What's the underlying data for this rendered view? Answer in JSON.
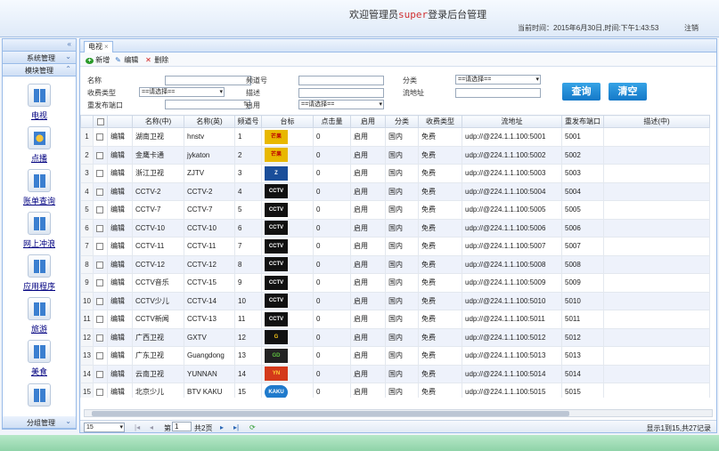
{
  "header": {
    "title_prefix": "欢迎管理员",
    "title_user": "super",
    "title_suffix": "登录后台管理",
    "time": "当前时间：2015年6月30日,时间:下午1:43:53",
    "logout": "注销"
  },
  "sidebar": {
    "collapse": "«",
    "system": "系统管理",
    "module": "模块管理",
    "group": "分组管理",
    "items": [
      {
        "label": "电视",
        "icon": "tv-icon"
      },
      {
        "label": "点播",
        "icon": "vod-icon"
      },
      {
        "label": "账单查询",
        "icon": "bill-icon"
      },
      {
        "label": "网上冲浪",
        "icon": "web-icon"
      },
      {
        "label": "应用程序",
        "icon": "apps-icon"
      },
      {
        "label": "旅游",
        "icon": "travel-icon"
      },
      {
        "label": "美食",
        "icon": "food-icon"
      }
    ]
  },
  "tab": {
    "label": "电视",
    "close": "×"
  },
  "toolbar": {
    "add": "新增",
    "edit": "编辑",
    "delete": "删除"
  },
  "search": {
    "name": "名称",
    "channel": "频道号",
    "category": "分类",
    "fee": "收费类型",
    "desc": "描述",
    "stream": "流地址",
    "port": "重发布端口",
    "enable": "启用",
    "select_placeholder": "==请选择==",
    "query": "查询",
    "clear": "清空"
  },
  "columns": [
    "",
    "名称(中)",
    "名称(英)",
    "频道号",
    "台标",
    "点击量",
    "启用",
    "分类",
    "收费类型",
    "流地址",
    "重发布端口",
    "描述(中)"
  ],
  "rows": [
    {
      "n": "1",
      "zh": "湖南卫视",
      "en": "hnstv",
      "ch": "1",
      "logo": "y",
      "logo_text": "芒果",
      "clicks": "0",
      "enable": "启用",
      "cat": "国内",
      "fee": "免费",
      "url": "udp://@224.1.1.100:5001",
      "port": "5001"
    },
    {
      "n": "2",
      "zh": "金鹰卡通",
      "en": "jykaton",
      "ch": "2",
      "logo": "y",
      "logo_text": "芒果",
      "clicks": "0",
      "enable": "启用",
      "cat": "国内",
      "fee": "免费",
      "url": "udp://@224.1.1.100:5002",
      "port": "5002"
    },
    {
      "n": "3",
      "zh": "浙江卫视",
      "en": "ZJTV",
      "ch": "3",
      "logo": "zj",
      "logo_text": "Z",
      "clicks": "0",
      "enable": "启用",
      "cat": "国内",
      "fee": "免费",
      "url": "udp://@224.1.1.100:5003",
      "port": "5003"
    },
    {
      "n": "4",
      "zh": "CCTV-2",
      "en": "CCTV-2",
      "ch": "4",
      "logo": "c",
      "logo_text": "CCTV",
      "clicks": "0",
      "enable": "启用",
      "cat": "国内",
      "fee": "免费",
      "url": "udp://@224.1.1.100:5004",
      "port": "5004"
    },
    {
      "n": "5",
      "zh": "CCTV-7",
      "en": "CCTV-7",
      "ch": "5",
      "logo": "c",
      "logo_text": "CCTV",
      "clicks": "0",
      "enable": "启用",
      "cat": "国内",
      "fee": "免费",
      "url": "udp://@224.1.1.100:5005",
      "port": "5005"
    },
    {
      "n": "6",
      "zh": "CCTV-10",
      "en": "CCTV-10",
      "ch": "6",
      "logo": "c",
      "logo_text": "CCTV",
      "clicks": "0",
      "enable": "启用",
      "cat": "国内",
      "fee": "免费",
      "url": "udp://@224.1.1.100:5006",
      "port": "5006"
    },
    {
      "n": "7",
      "zh": "CCTV-11",
      "en": "CCTV-11",
      "ch": "7",
      "logo": "c",
      "logo_text": "CCTV",
      "clicks": "0",
      "enable": "启用",
      "cat": "国内",
      "fee": "免费",
      "url": "udp://@224.1.1.100:5007",
      "port": "5007"
    },
    {
      "n": "8",
      "zh": "CCTV-12",
      "en": "CCTV-12",
      "ch": "8",
      "logo": "c",
      "logo_text": "CCTV",
      "clicks": "0",
      "enable": "启用",
      "cat": "国内",
      "fee": "免费",
      "url": "udp://@224.1.1.100:5008",
      "port": "5008"
    },
    {
      "n": "9",
      "zh": "CCTV音乐",
      "en": "CCTV-15",
      "ch": "9",
      "logo": "c",
      "logo_text": "CCTV",
      "clicks": "0",
      "enable": "启用",
      "cat": "国内",
      "fee": "免费",
      "url": "udp://@224.1.1.100:5009",
      "port": "5009"
    },
    {
      "n": "10",
      "zh": "CCTV少儿",
      "en": "CCTV-14",
      "ch": "10",
      "logo": "c",
      "logo_text": "CCTV",
      "clicks": "0",
      "enable": "启用",
      "cat": "国内",
      "fee": "免费",
      "url": "udp://@224.1.1.100:5010",
      "port": "5010"
    },
    {
      "n": "11",
      "zh": "CCTV新闻",
      "en": "CCTV-13",
      "ch": "11",
      "logo": "c",
      "logo_text": "CCTV",
      "clicks": "0",
      "enable": "启用",
      "cat": "国内",
      "fee": "免费",
      "url": "udp://@224.1.1.100:5011",
      "port": "5011"
    },
    {
      "n": "12",
      "zh": "广西卫视",
      "en": "GXTV",
      "ch": "12",
      "logo": "gx",
      "logo_text": "G",
      "clicks": "0",
      "enable": "启用",
      "cat": "国内",
      "fee": "免费",
      "url": "udp://@224.1.1.100:5012",
      "port": "5012"
    },
    {
      "n": "13",
      "zh": "广东卫视",
      "en": "Guangdong",
      "ch": "13",
      "logo": "gd",
      "logo_text": "GD",
      "clicks": "0",
      "enable": "启用",
      "cat": "国内",
      "fee": "免费",
      "url": "udp://@224.1.1.100:5013",
      "port": "5013"
    },
    {
      "n": "14",
      "zh": "云南卫视",
      "en": "YUNNAN",
      "ch": "14",
      "logo": "yn",
      "logo_text": "YN",
      "clicks": "0",
      "enable": "启用",
      "cat": "国内",
      "fee": "免费",
      "url": "udp://@224.1.1.100:5014",
      "port": "5014"
    },
    {
      "n": "15",
      "zh": "北京少儿",
      "en": "BTV KAKU",
      "ch": "15",
      "logo": "kk",
      "logo_text": "KAKU",
      "clicks": "0",
      "enable": "启用",
      "cat": "国内",
      "fee": "免费",
      "url": "udp://@224.1.1.100:5015",
      "port": "5015"
    }
  ],
  "edit_label": "编辑",
  "pager": {
    "page_size": "15",
    "page_prefix": "第",
    "page": "1",
    "page_total": "共2页",
    "summary": "显示1到15,共27记录"
  }
}
